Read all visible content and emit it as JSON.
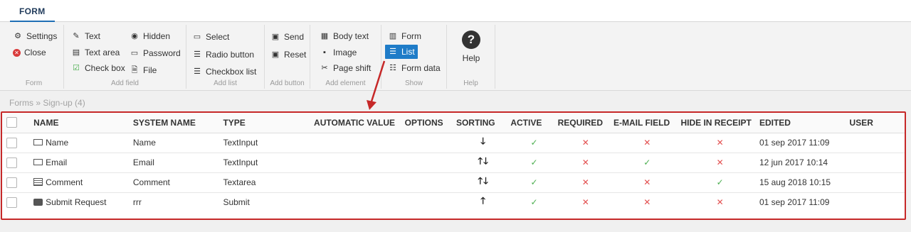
{
  "tab": {
    "label": "FORM"
  },
  "ribbon": {
    "groups": {
      "form": {
        "label": "Form",
        "items": [
          {
            "label": "Settings",
            "icon": "gear-icon"
          },
          {
            "label": "Close",
            "icon": "close-circle-icon"
          }
        ]
      },
      "add_field": {
        "label": "Add field",
        "items": [
          {
            "label": "Text",
            "icon": "pencil-icon"
          },
          {
            "label": "Text area",
            "icon": "textarea-icon"
          },
          {
            "label": "Check box",
            "icon": "checkbox-icon"
          },
          {
            "label": "Hidden",
            "icon": "eye-slash-icon"
          },
          {
            "label": "Password",
            "icon": "password-icon"
          },
          {
            "label": "File",
            "icon": "file-icon"
          }
        ]
      },
      "add_list": {
        "label": "Add list",
        "items": [
          {
            "label": "Select",
            "icon": "select-icon"
          },
          {
            "label": "Radio button",
            "icon": "radio-list-icon"
          },
          {
            "label": "Checkbox list",
            "icon": "checkbox-list-icon"
          }
        ]
      },
      "add_button": {
        "label": "Add button",
        "items": [
          {
            "label": "Send",
            "icon": "send-icon"
          },
          {
            "label": "Reset",
            "icon": "reset-icon"
          }
        ]
      },
      "add_element": {
        "label": "Add element",
        "items": [
          {
            "label": "Body text",
            "icon": "body-text-icon"
          },
          {
            "label": "Image",
            "icon": "image-icon"
          },
          {
            "label": "Page shift",
            "icon": "scissors-icon"
          }
        ]
      },
      "show": {
        "label": "Show",
        "items": [
          {
            "label": "Form",
            "icon": "form-icon"
          },
          {
            "label": "List",
            "icon": "list-icon"
          },
          {
            "label": "Form data",
            "icon": "database-icon"
          }
        ]
      },
      "help": {
        "label": "Help",
        "button_label": "Help",
        "icon": "question-icon"
      }
    }
  },
  "breadcrumb": "Forms » Sign-up (4)",
  "table": {
    "columns": [
      "NAME",
      "SYSTEM NAME",
      "TYPE",
      "AUTOMATIC VALUE",
      "OPTIONS",
      "SORTING",
      "ACTIVE",
      "REQUIRED",
      "E-MAIL FIELD",
      "HIDE IN RECEIPT",
      "EDITED",
      "USER"
    ],
    "rows": [
      {
        "name": "Name",
        "system_name": "Name",
        "type": "TextInput",
        "sorting": "down",
        "active": true,
        "required": false,
        "email_field": false,
        "hide_in_receipt": false,
        "edited": "01 sep 2017 11:09",
        "user": ""
      },
      {
        "name": "Email",
        "system_name": "Email",
        "type": "TextInput",
        "sorting": "up-down",
        "active": true,
        "required": false,
        "email_field": true,
        "hide_in_receipt": false,
        "edited": "12 jun 2017 10:14",
        "user": ""
      },
      {
        "name": "Comment",
        "system_name": "Comment",
        "type": "Textarea",
        "sorting": "up-down",
        "active": true,
        "required": false,
        "email_field": false,
        "hide_in_receipt": true,
        "edited": "15 aug 2018 10:15",
        "user": ""
      },
      {
        "name": "Submit Request",
        "system_name": "rrr",
        "type": "Submit",
        "sorting": "up",
        "active": true,
        "required": false,
        "email_field": false,
        "hide_in_receipt": false,
        "edited": "01 sep 2017 11:09",
        "user": ""
      }
    ]
  },
  "colors": {
    "accent": "#1f7cc8",
    "highlight_border": "#c62828",
    "check": "#4caf50",
    "cross": "#e35050"
  }
}
